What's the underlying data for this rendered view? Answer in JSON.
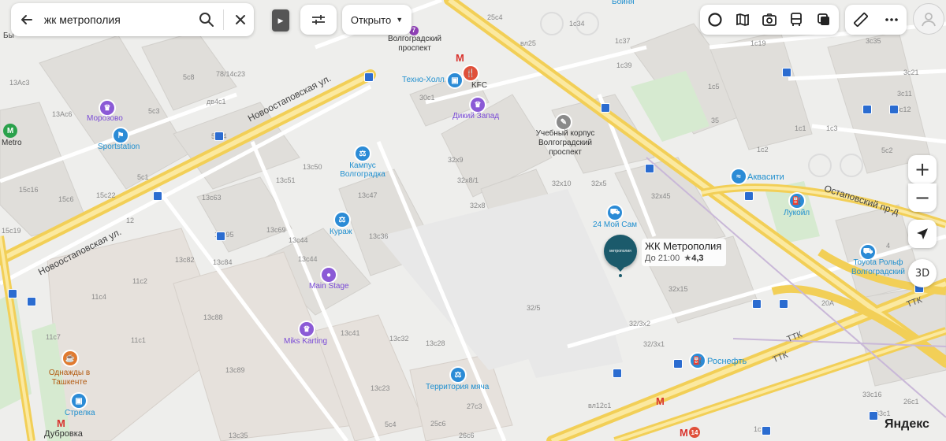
{
  "search": {
    "value": "жк метрополия"
  },
  "toolbar": {
    "filter_label": "Открыто",
    "filter_arrow": "▼",
    "play_icon": "▶"
  },
  "map": {
    "streets": [
      "Новоостаповская ул.",
      "Новоостаповская ул.",
      "Остаповский пр-д",
      "ТТК",
      "ТТК",
      "ТТК"
    ],
    "numbers": [
      "13Ас3",
      "13Ас6",
      "5с8",
      "78/14с23",
      "25с4",
      "вл25",
      "1с34",
      "1с37",
      "1с39",
      "1с19",
      "3с35",
      "3с21",
      "3с11",
      "3с12",
      "1с5",
      "35",
      "1с1",
      "1с2",
      "1с3",
      "5с2",
      "32х9",
      "32х8/1",
      "32х8",
      "32х10",
      "32х5",
      "32х45",
      "32х15",
      "32/3х2",
      "32/3х1",
      "32/5",
      "20А",
      "4",
      "30с1",
      "дв4с1",
      "5с3",
      "5с14",
      "5с1",
      "13с50",
      "13с51",
      "13с63",
      "13с47",
      "13с69",
      "13с95",
      "13с44",
      "13с36",
      "13с82",
      "13с84",
      "13с88",
      "13с89",
      "13с41",
      "13с32",
      "13с28",
      "13с23",
      "11с4",
      "11с2",
      "11с1",
      "11с7",
      "15с6",
      "15с16",
      "15с19",
      "15с22",
      "12",
      "27с3",
      "25с6",
      "26с6",
      "1с31",
      "26с1",
      "33с16",
      "33с1",
      "вл12с1",
      "5с4",
      "13с35",
      "13с44"
    ],
    "metro_labels": [
      "Волгоградский проспект",
      "Metro",
      "Дубровка"
    ],
    "poi_labels": {
      "transport": [
        "Техно-Холл",
        "Sportstation",
        "Кампус Волгоградка",
        "Кураж",
        "Main Stage",
        "Miks Karting",
        "Территория мяча",
        "Стрелка",
        "Аквасити",
        "Лукойл",
        "24 Мой Сам",
        "Роснефть",
        "Toyota Рольф Волгоградский"
      ],
      "purple": [
        "Морозово",
        "Дикий Запад"
      ],
      "orange": [
        "Однажды в Ташкенте"
      ],
      "edu": [
        "Учебный корпус Волгоградский проспект"
      ],
      "food": [
        "KFC"
      ],
      "top_right": [
        "Бойня"
      ],
      "top_left": [
        "Бы"
      ]
    },
    "metro_badge": "7",
    "metro_badge_14": "14"
  },
  "selected_place": {
    "name": "ЖК Метрополия",
    "hours": "До 21:00",
    "rating_star": "★",
    "rating": "4,3",
    "logo_text": "метрополия"
  },
  "controls": {
    "zoom_in": "+",
    "zoom_out": "−",
    "three_d": "3D"
  },
  "brand": {
    "logo": "Яндекс"
  },
  "colors": {
    "accent": "#1f8fcf",
    "road": "#f5d96e",
    "place_pin": "#1b5a6b",
    "metro": "#d9332e"
  }
}
